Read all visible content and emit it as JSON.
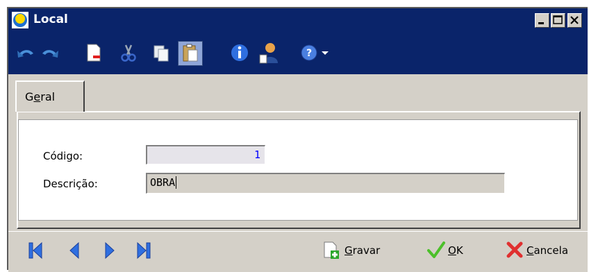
{
  "window": {
    "title": "Local"
  },
  "tabs": [
    {
      "label": "Geral",
      "underline_index": 1
    }
  ],
  "form": {
    "codigo": {
      "label": "Código:",
      "value": "1"
    },
    "descricao": {
      "label": "Descrição:",
      "value": "OBRA"
    }
  },
  "actions": {
    "gravar": {
      "underline": "G",
      "rest": "ravar"
    },
    "ok": {
      "underline": "O",
      "rest": "K"
    },
    "cancela": {
      "underline": "C",
      "rest": "ancela"
    }
  },
  "icons": {
    "toolbar": [
      "undo-icon",
      "redo-icon",
      "new-document-icon",
      "cut-icon",
      "copy-icon",
      "paste-icon",
      "info-icon",
      "user-icon",
      "help-icon",
      "dropdown-arrow-icon"
    ],
    "navigation": [
      "first-record-icon",
      "previous-record-icon",
      "next-record-icon",
      "last-record-icon"
    ]
  },
  "colors": {
    "titlebar": "#0a246a",
    "chrome": "#d4d0c8",
    "code_value": "#0000ff"
  }
}
